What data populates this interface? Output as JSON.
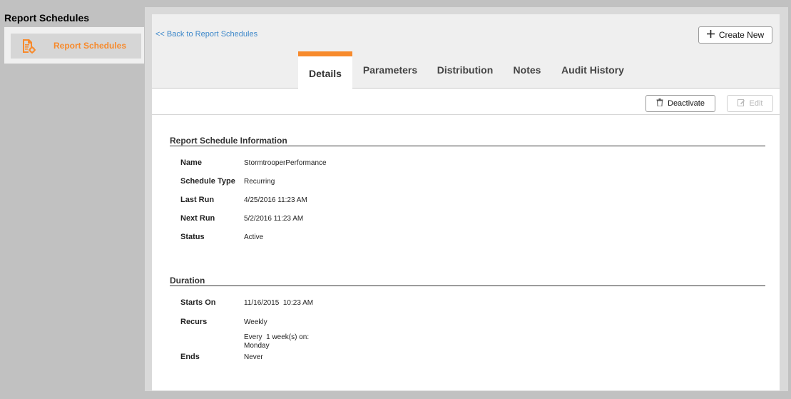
{
  "sidebar": {
    "title": "Report Schedules",
    "items": [
      {
        "label": "Report Schedules",
        "icon": "report-settings-icon"
      }
    ]
  },
  "header": {
    "back_label": "<< Back to Report Schedules",
    "create_label": "Create New"
  },
  "tabs": [
    {
      "label": "Details",
      "active": true
    },
    {
      "label": "Parameters"
    },
    {
      "label": "Distribution"
    },
    {
      "label": "Notes"
    },
    {
      "label": "Audit History"
    }
  ],
  "toolbar": {
    "deactivate_label": "Deactivate",
    "edit_label": "Edit"
  },
  "info": {
    "title": "Report Schedule Information",
    "rows": [
      {
        "label": "Name",
        "value": "StormtrooperPerformance"
      },
      {
        "label": "Schedule Type",
        "value": "Recurring"
      },
      {
        "label": "Last Run",
        "value": "4/25/2016 11:23 AM"
      },
      {
        "label": "Next Run",
        "value": "5/2/2016 11:23 AM"
      },
      {
        "label": "Status",
        "value": "Active"
      }
    ]
  },
  "duration": {
    "title": "Duration",
    "starts_label": "Starts On",
    "starts_value": "11/16/2015  10:23 AM",
    "recurs_label": "Recurs",
    "recurs_value": "Weekly",
    "recurs_detail_1": "Every  1 week(s) on:",
    "recurs_detail_2": "Monday",
    "ends_label": "Ends",
    "ends_value": "Never"
  },
  "colors": {
    "accent": "#f78a2c",
    "link": "#3c87c9"
  }
}
